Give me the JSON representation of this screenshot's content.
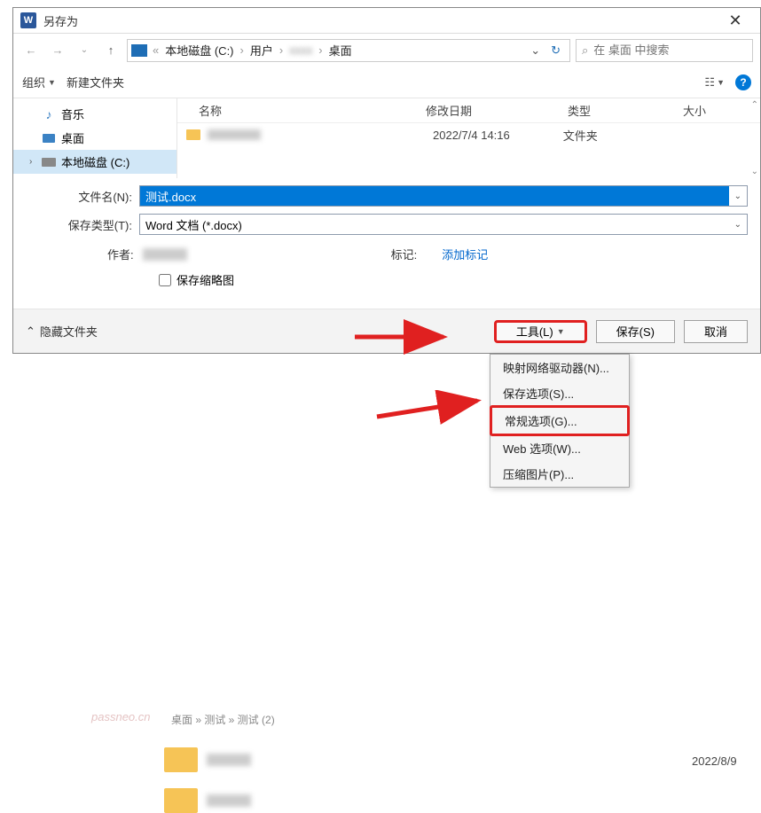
{
  "titlebar": {
    "title": "另存为"
  },
  "nav": {
    "crumbs": {
      "root_icon": "drive",
      "c1": "本地磁盘 (C:)",
      "c2": "用户",
      "c3_blur": true,
      "c4": "桌面"
    },
    "search_placeholder": "在 桌面 中搜索"
  },
  "toolbar": {
    "organize": "组织",
    "new_folder": "新建文件夹"
  },
  "sidebar": {
    "items": [
      {
        "label": "音乐",
        "icon": "music"
      },
      {
        "label": "桌面",
        "icon": "desktop"
      },
      {
        "label": "本地磁盘 (C:)",
        "icon": "drive",
        "selected": true,
        "expandable": true
      }
    ]
  },
  "filelist": {
    "headers": {
      "name": "名称",
      "date": "修改日期",
      "type": "类型",
      "size": "大小"
    },
    "rows": [
      {
        "name_blur": true,
        "date": "2022/7/4 14:16",
        "type": "文件夹"
      }
    ]
  },
  "form": {
    "filename_label": "文件名(N):",
    "filename_value": "测试.docx",
    "filetype_label": "保存类型(T):",
    "filetype_value": "Word 文档 (*.docx)",
    "author_label": "作者:",
    "tag_label": "标记:",
    "add_tag": "添加标记",
    "save_thumb": "保存缩略图"
  },
  "footer": {
    "hide_folders": "隐藏文件夹",
    "tools": "工具(L)",
    "save": "保存(S)",
    "cancel": "取消"
  },
  "tools_menu": {
    "items": [
      "映射网络驱动器(N)...",
      "保存选项(S)...",
      "常规选项(G)...",
      "Web 选项(W)...",
      "压缩图片(P)..."
    ]
  },
  "background": {
    "watermark": "passneo.cn",
    "crumb": "桌面 » 测试 » 测试 (2)",
    "date1": "2022/8/9"
  }
}
